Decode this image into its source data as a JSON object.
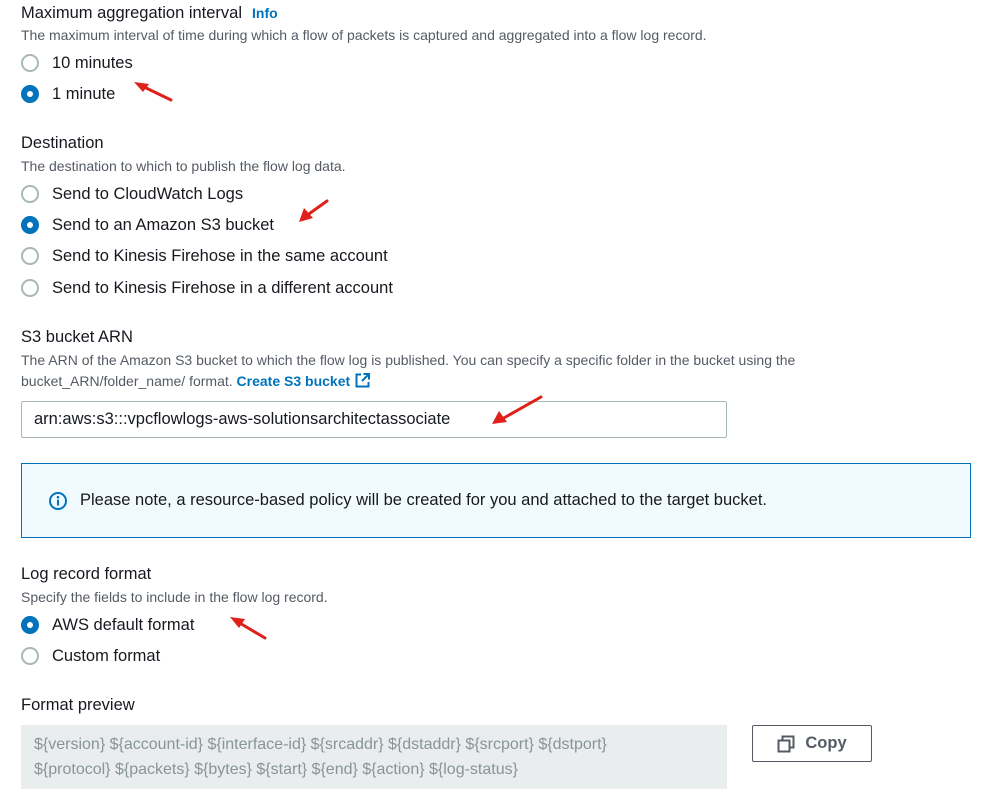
{
  "aggregation": {
    "title": "Maximum aggregation interval",
    "info_label": "Info",
    "description": "The maximum interval of time during which a flow of packets is captured and aggregated into a flow log record.",
    "options": [
      {
        "label": "10 minutes",
        "checked": false
      },
      {
        "label": "1 minute",
        "checked": true
      }
    ]
  },
  "destination": {
    "title": "Destination",
    "description": "The destination to which to publish the flow log data.",
    "options": [
      {
        "label": "Send to CloudWatch Logs",
        "checked": false
      },
      {
        "label": "Send to an Amazon S3 bucket",
        "checked": true
      },
      {
        "label": "Send to Kinesis Firehose in the same account",
        "checked": false
      },
      {
        "label": "Send to Kinesis Firehose in a different account",
        "checked": false
      }
    ]
  },
  "s3_bucket": {
    "title": "S3 bucket ARN",
    "description_line1": "The ARN of the Amazon S3 bucket to which the flow log is published. You can specify a specific folder in the bucket using the",
    "description_line2": "bucket_ARN/folder_name/ format.",
    "create_link": "Create S3 bucket",
    "value": "arn:aws:s3:::vpcflowlogs-aws-solutionsarchitectassociate"
  },
  "alert": {
    "icon": "info-circle-icon",
    "text": "Please note, a resource-based policy will be created for you and attached to the target bucket."
  },
  "log_format": {
    "title": "Log record format",
    "description": "Specify the fields to include in the flow log record.",
    "options": [
      {
        "label": "AWS default format",
        "checked": true
      },
      {
        "label": "Custom format",
        "checked": false
      }
    ]
  },
  "format_preview": {
    "title": "Format preview",
    "line1": "${version} ${account-id} ${interface-id} ${srcaddr} ${dstaddr} ${srcport} ${dstport}",
    "line2": "${protocol} ${packets} ${bytes} ${start} ${end} ${action} ${log-status}",
    "copy_label": "Copy",
    "copy_icon": "copy-icon"
  },
  "colors": {
    "accent": "#0073bb",
    "annotation_arrow": "#e0201b",
    "alert_background": "#f1faff",
    "preview_background": "#eaeded"
  }
}
